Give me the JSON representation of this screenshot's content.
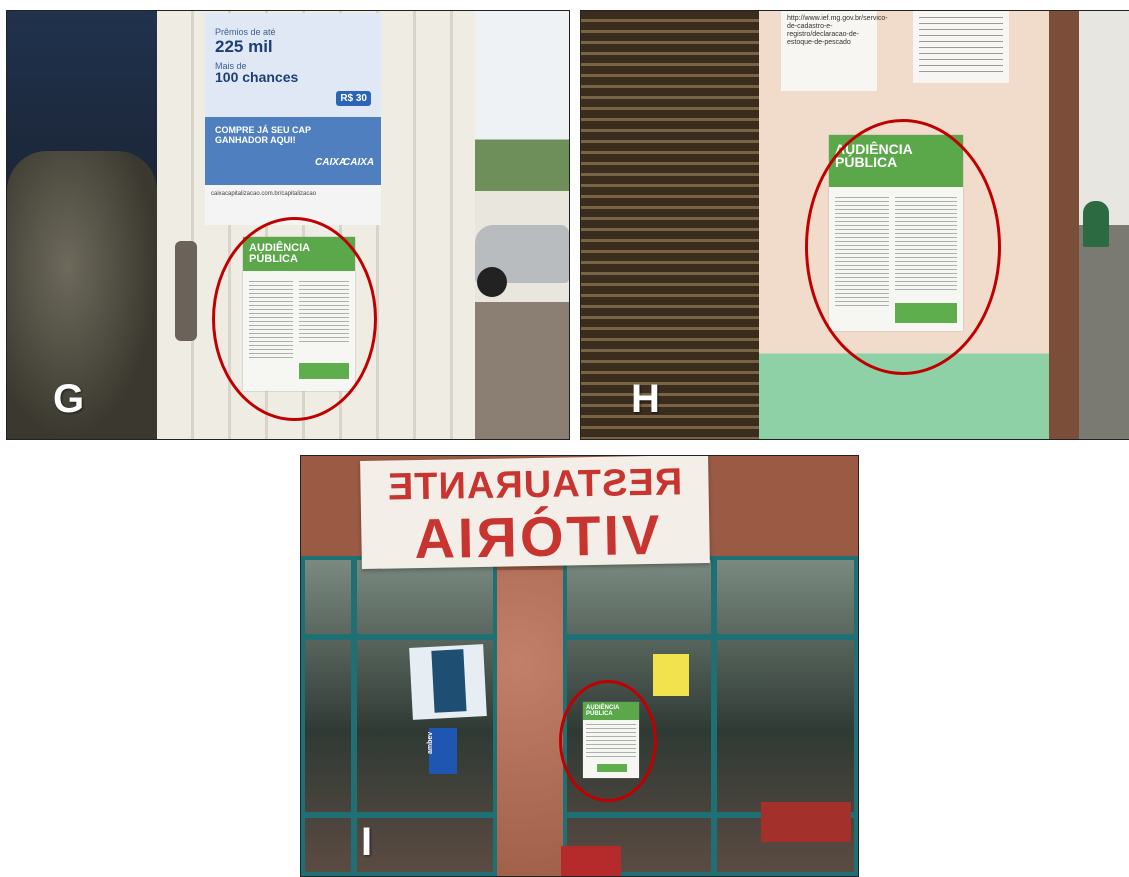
{
  "panels": {
    "g": {
      "letter": "G",
      "caixa_poster": {
        "prize_prefix": "Prêmios de até",
        "prize": "225 mil",
        "chances_prefix": "Mais de",
        "chances": "100 chances",
        "price": "R$ 30",
        "cta": "COMPRE JÁ SEU CAP GANHADOR AQUI!",
        "brand_left": "CAIXA",
        "brand_right": "CAIXA",
        "url": "caixacapitalizacao.com.br/capitalizacao"
      },
      "audiencia_poster": {
        "title": "AUDIÊNCIA PÚBLICA"
      }
    },
    "h": {
      "letter": "H",
      "note_text": "http://www.ief.mg.gov.br/servico-de-cadastro-e-registro/declaracao-de-estoque-de-pescado",
      "audiencia_poster": {
        "title": "AUDIÊNCIA PÚBLICA"
      }
    },
    "i": {
      "letter": "I",
      "sign_line1": "RESTAURANTE",
      "sign_line2": "VITÒRIA",
      "ambev": "ambev",
      "audiencia_poster": {
        "title": "AUDIÊNCIA PÚBLICA"
      }
    }
  },
  "colors": {
    "highlight_ring": "#c00000",
    "poster_green": "#5aa84a",
    "sign_red": "#c8342f",
    "window_frame": "#1e7074"
  }
}
